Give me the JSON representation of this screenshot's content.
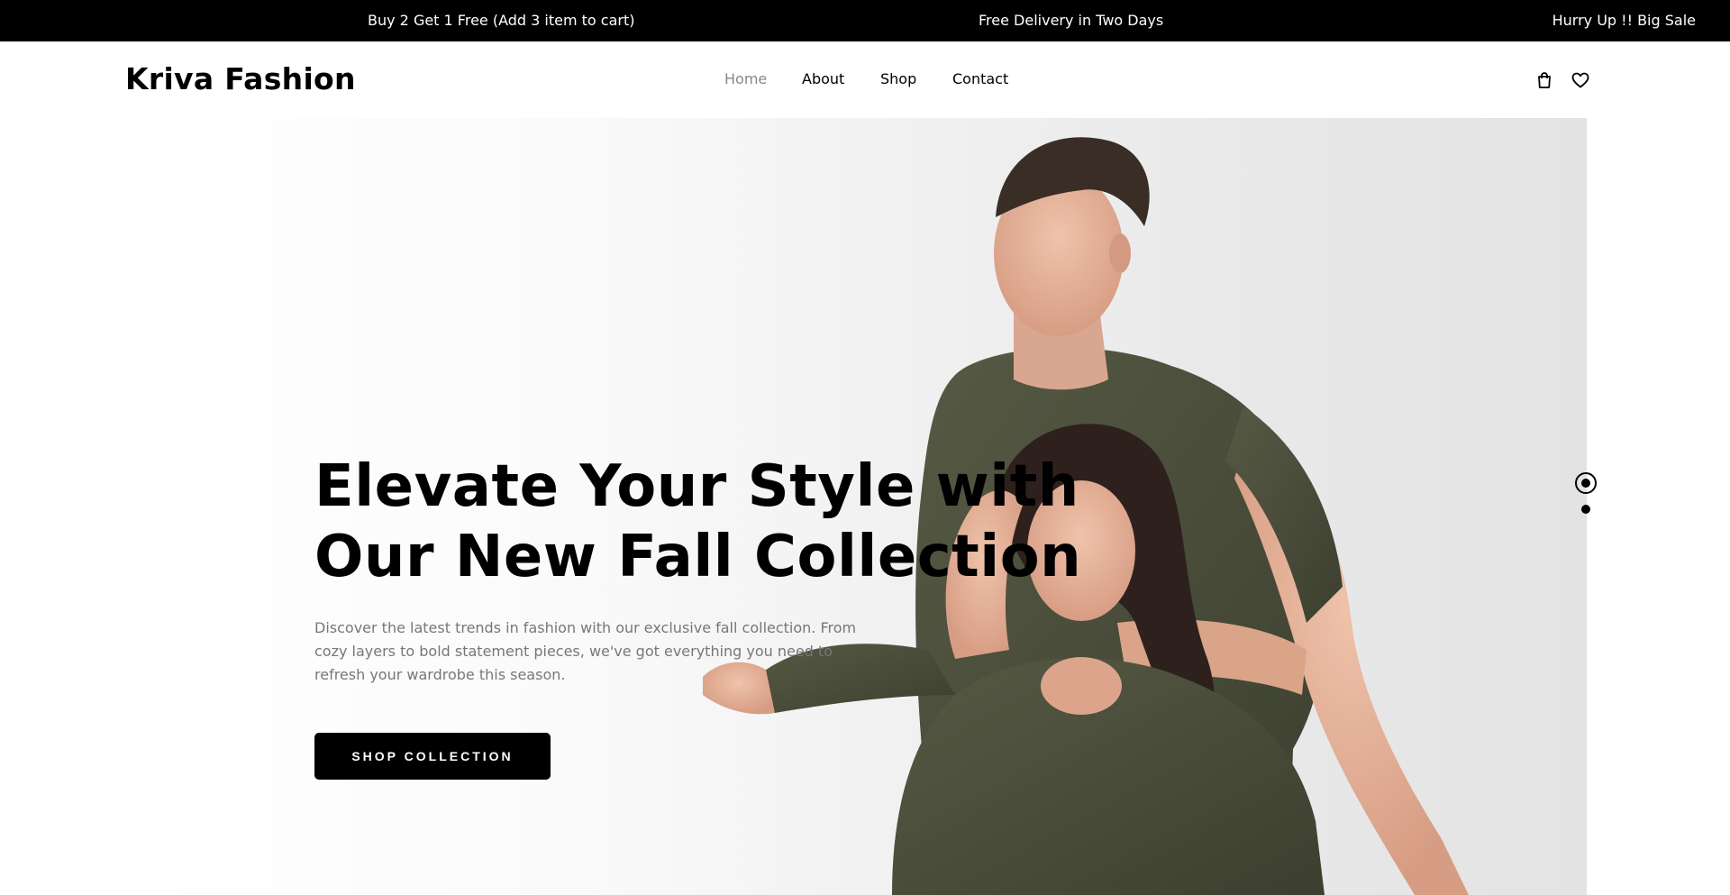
{
  "announcement": {
    "items": [
      "Buy 2 Get 1 Free (Add 3 item to cart)",
      "Free Delivery in Two Days",
      "Hurry Up !! Big Sale"
    ]
  },
  "header": {
    "logo": "Kriva Fashion",
    "nav": [
      "Home",
      "About",
      "Shop",
      "Contact"
    ],
    "active_nav": "Home",
    "icons": [
      "shopping-bag-icon",
      "heart-icon"
    ]
  },
  "hero": {
    "title_line1": "Elevate Your Style with",
    "title_line2": "Our New Fall Collection",
    "description": "Discover the latest trends in fashion with our exclusive fall collection. From cozy layers to bold statement pieces, we've got everything you need to refresh your wardrobe this season.",
    "cta": "SHOP COLLECTION",
    "slides": 2,
    "active_slide": 1
  },
  "colors": {
    "bar": "#000000",
    "accent": "#1e9e3a",
    "sweater": "#4a4d3a",
    "muted_text": "#777777"
  }
}
